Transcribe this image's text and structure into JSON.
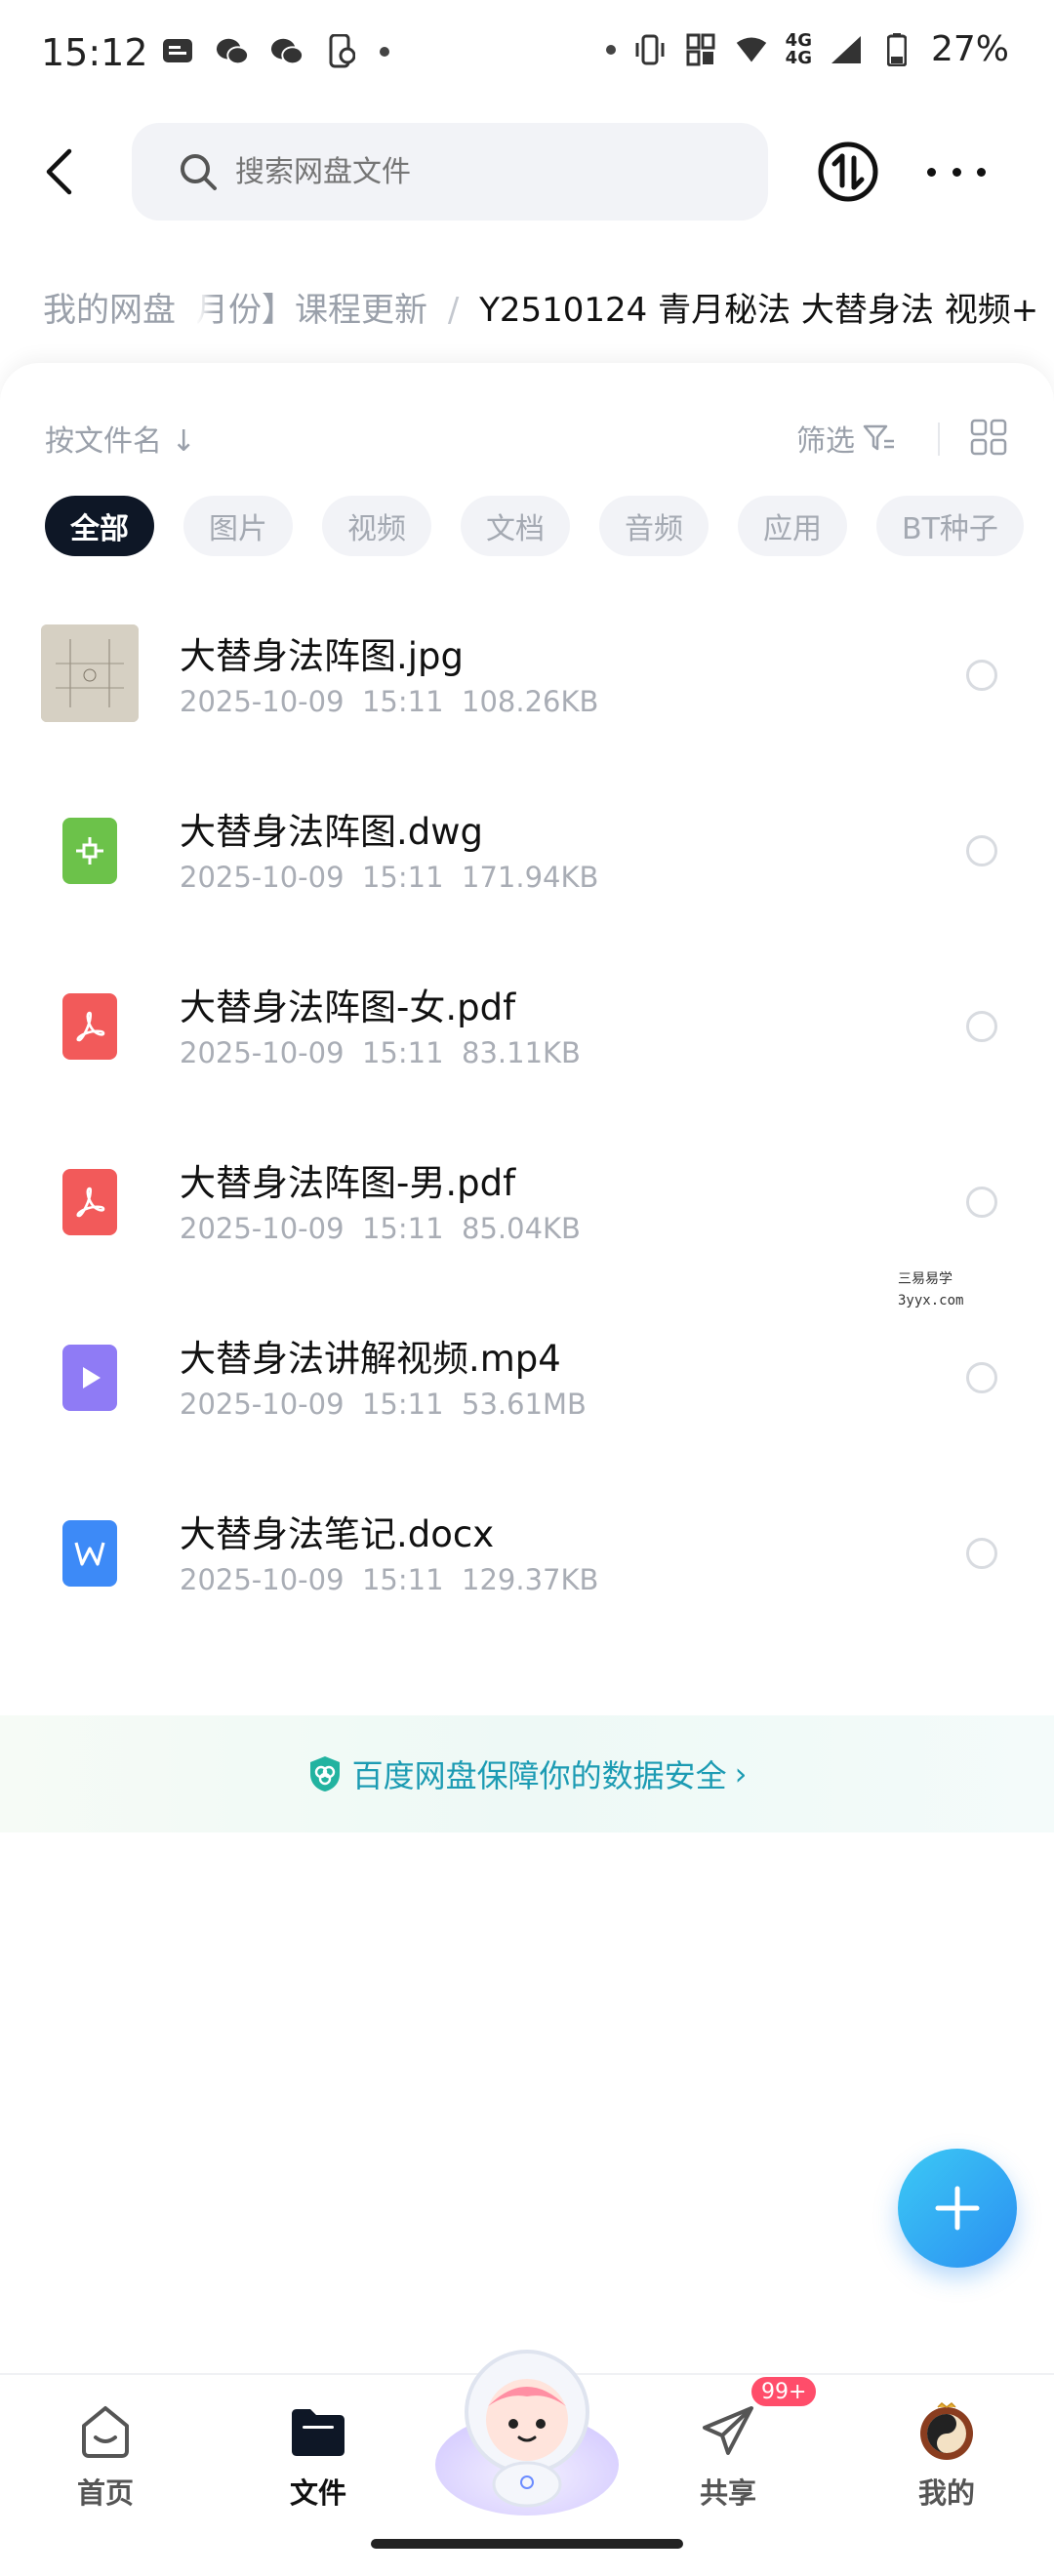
{
  "status_bar": {
    "time": "15:12",
    "battery": "27%",
    "network": "4G",
    "network2": "4G",
    "wifi_level": "6",
    "icons": [
      "message-icon",
      "wechat-icon",
      "wechat-icon",
      "phone-icon",
      "vibrate-icon",
      "nfc-icon",
      "wifi-icon",
      "signal-icon",
      "battery-icon"
    ]
  },
  "topbar": {
    "search_placeholder": "搜索网盘文件"
  },
  "breadcrumb": {
    "root": "我的网盘",
    "trail": "月份】课程更新",
    "separator": "/",
    "current": "Y2510124 青月秘法 大替身法 视频+"
  },
  "toolbar": {
    "sort_label": "按文件名 ↓",
    "filter_label": "筛选"
  },
  "chips": [
    {
      "label": "全部",
      "active": true
    },
    {
      "label": "图片"
    },
    {
      "label": "视频"
    },
    {
      "label": "文档"
    },
    {
      "label": "音频"
    },
    {
      "label": "应用"
    },
    {
      "label": "BT种子"
    }
  ],
  "files": [
    {
      "name": "大替身法阵图.jpg",
      "date": "2025-10-09",
      "time": "15:11",
      "size": "108.26KB",
      "type": "image"
    },
    {
      "name": "大替身法阵图.dwg",
      "date": "2025-10-09",
      "time": "15:11",
      "size": "171.94KB",
      "type": "dwg"
    },
    {
      "name": "大替身法阵图-女.pdf",
      "date": "2025-10-09",
      "time": "15:11",
      "size": "83.11KB",
      "type": "pdf"
    },
    {
      "name": "大替身法阵图-男.pdf",
      "date": "2025-10-09",
      "time": "15:11",
      "size": "85.04KB",
      "type": "pdf"
    },
    {
      "name": "大替身法讲解视频.mp4",
      "date": "2025-10-09",
      "time": "15:11",
      "size": "53.61MB",
      "type": "video"
    },
    {
      "name": "大替身法笔记.docx",
      "date": "2025-10-09",
      "time": "15:11",
      "size": "129.37KB",
      "type": "word"
    }
  ],
  "safety": {
    "text": "百度网盘保障你的数据安全",
    "chevron": "›"
  },
  "watermark": {
    "line1": "三易易学",
    "line2": "3yyx.com"
  },
  "bottom_nav": {
    "home": "首页",
    "files": "文件",
    "share": "共享",
    "me": "我的",
    "share_badge": "99+"
  },
  "colors": {
    "accent": "#2b8ff2",
    "active_chip": "#0e1726",
    "pdf": "#f25a5a",
    "dwg": "#6cc24a",
    "video": "#8f7bf5",
    "word": "#3d8af7",
    "badge": "#ff4d6a"
  }
}
